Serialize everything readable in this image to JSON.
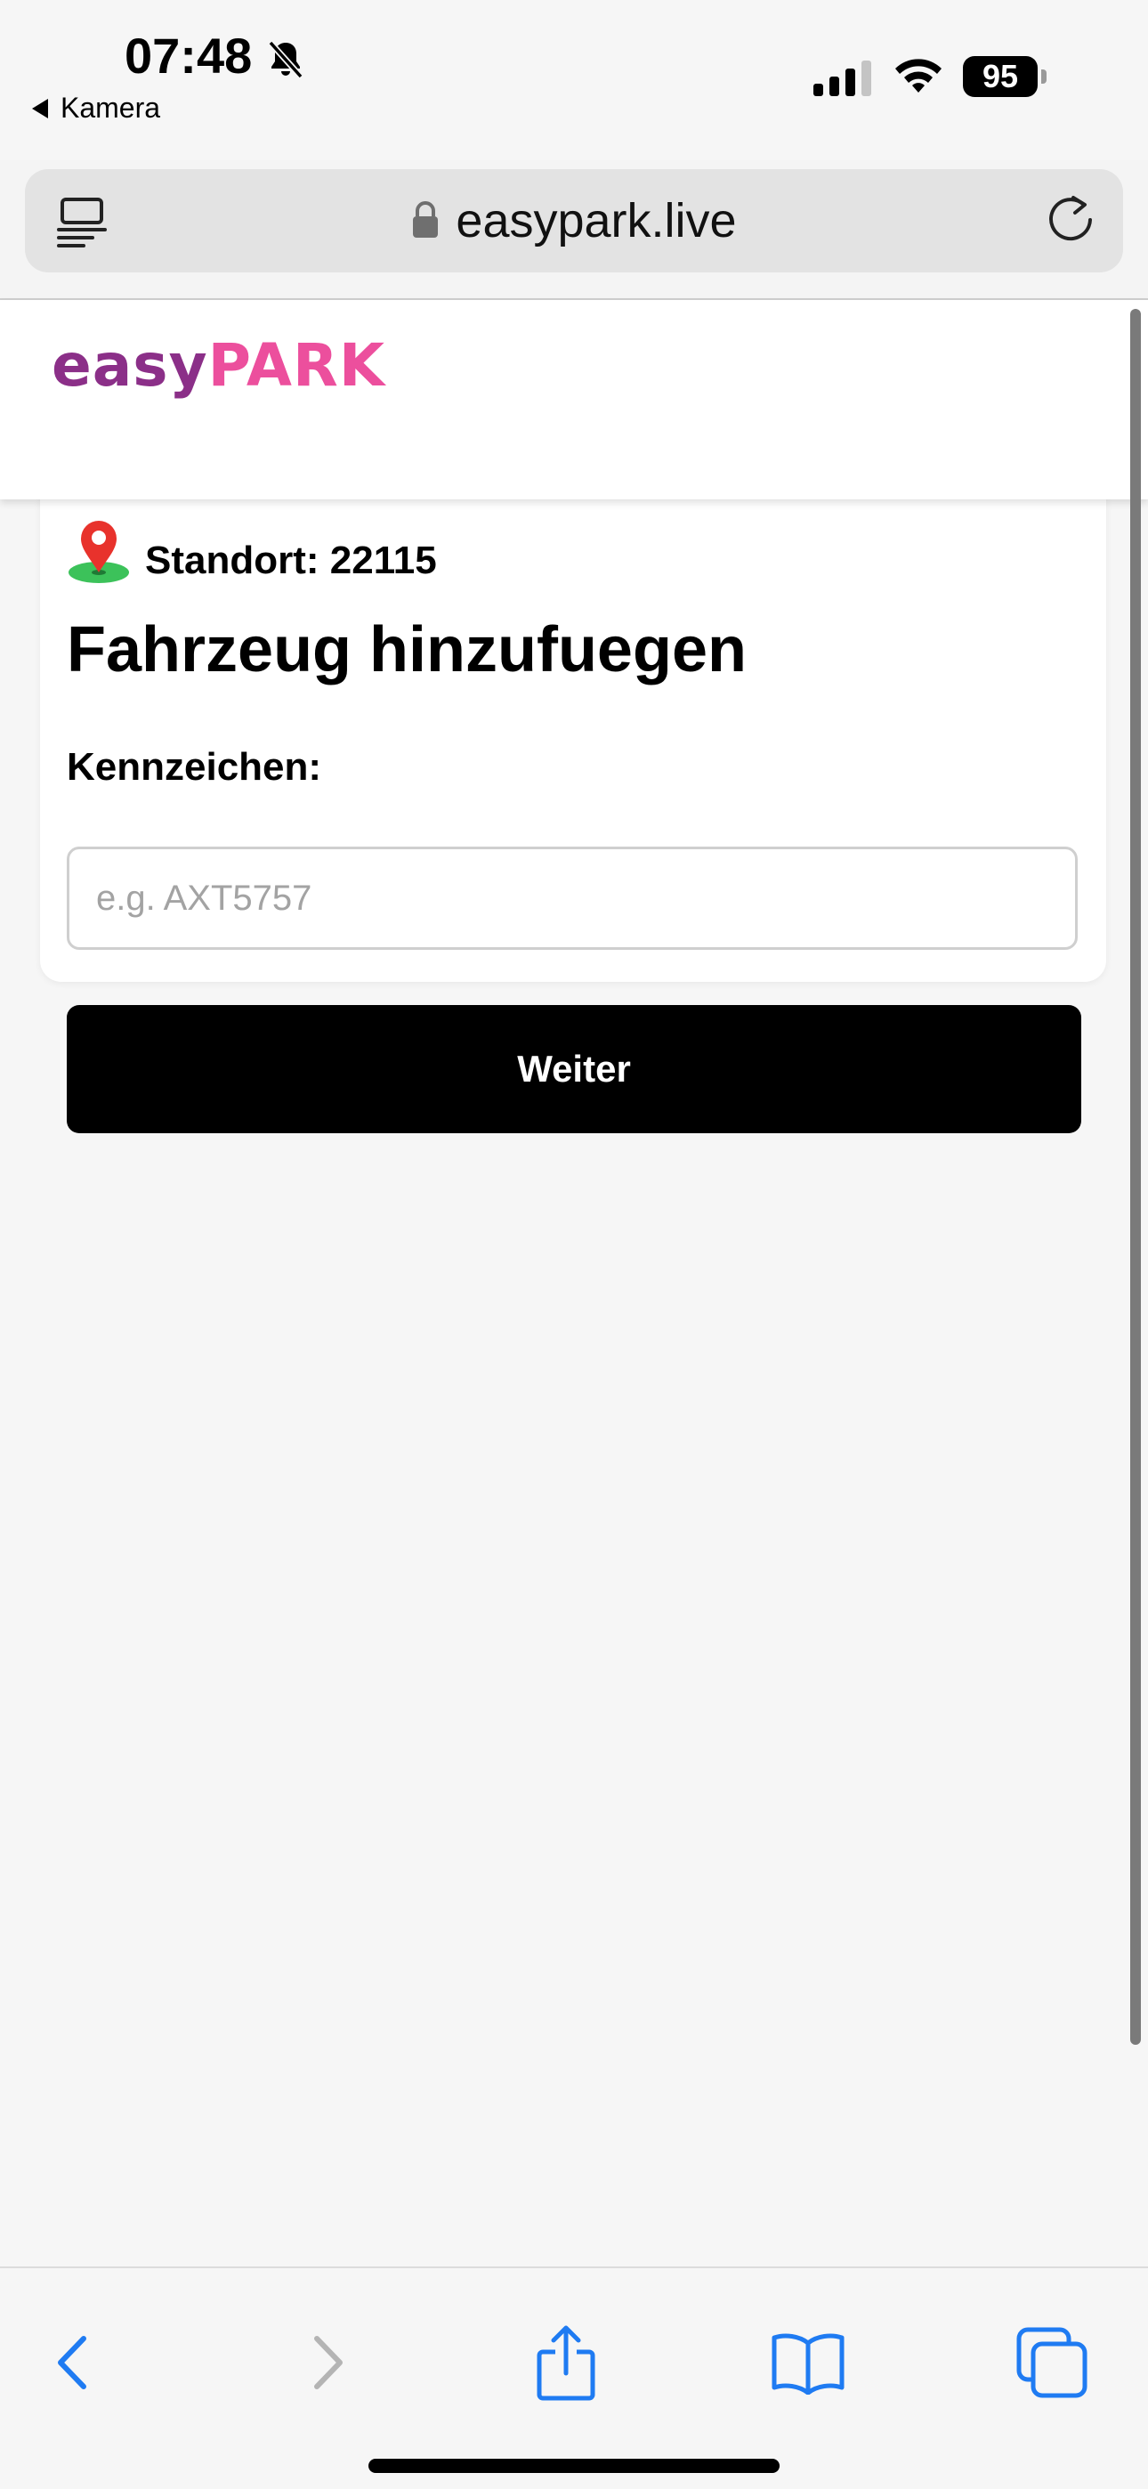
{
  "status_bar": {
    "time": "07:48",
    "back_app": "Kamera",
    "battery": "95",
    "icons": [
      "bell-muted-icon",
      "signal-icon",
      "wifi-icon",
      "battery-icon"
    ]
  },
  "browser": {
    "url": "easypark.live",
    "icons": [
      "reader-icon",
      "lock-icon",
      "reload-icon"
    ],
    "toolbar_icons": [
      "back-icon",
      "forward-icon",
      "share-icon",
      "bookmarks-icon",
      "tabs-icon"
    ]
  },
  "site": {
    "logo_part1": "easy",
    "logo_part2": "PARK",
    "colors": {
      "logo_primary": "#8b2f88",
      "logo_accent": "#ec4f9d",
      "button_bg": "#000000"
    }
  },
  "form": {
    "location_label": "Standort: 22115",
    "title": "Fahrzeug hinzufuegen",
    "plate_label": "Kennzeichen:",
    "plate_placeholder": "e.g. AXT5757",
    "plate_value": "",
    "submit_label": "Weiter"
  }
}
